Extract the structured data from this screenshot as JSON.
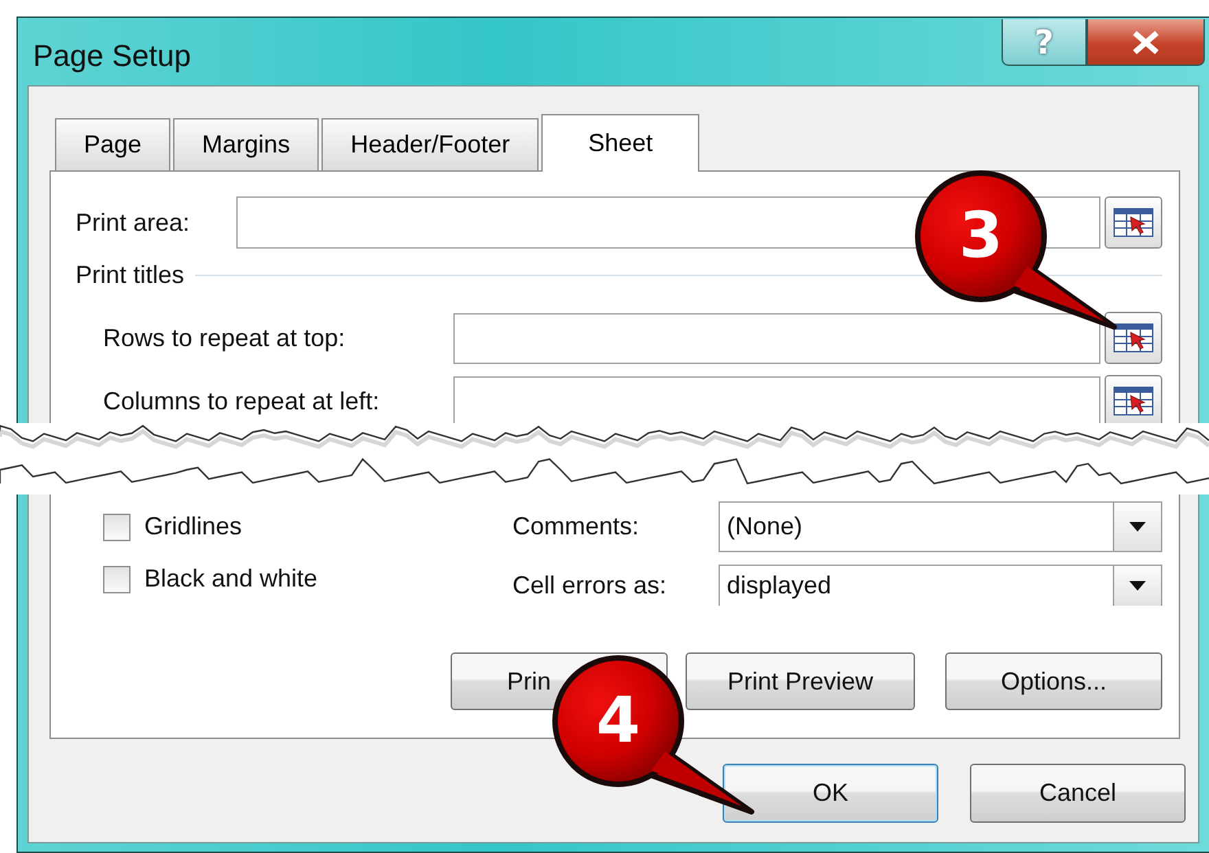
{
  "window": {
    "title": "Page Setup"
  },
  "title_buttons": [
    {
      "kind": "help",
      "label": "?"
    },
    {
      "kind": "close"
    }
  ],
  "tabs": [
    {
      "label": "Page",
      "selected": false
    },
    {
      "label": "Margins",
      "selected": false
    },
    {
      "label": "Header/Footer",
      "selected": false
    },
    {
      "label": "Sheet",
      "selected": true
    }
  ],
  "print_area": {
    "label": "Print area:"
  },
  "print_titles": {
    "heading": "Print titles",
    "rows": [
      {
        "label": "Rows to repeat at top:"
      },
      {
        "label": "Columns to repeat at left:"
      }
    ]
  },
  "print_options": [
    {
      "label": "Gridlines",
      "checked": false
    },
    {
      "label": "Black and white",
      "checked": false
    }
  ],
  "dropdowns": [
    {
      "label": "Comments:",
      "value": "(None)"
    },
    {
      "label": "Cell errors as:",
      "value": "displayed"
    }
  ],
  "panel_buttons": [
    "Prin",
    "Print Preview",
    "Options..."
  ],
  "dialog_buttons": [
    {
      "label": "OK",
      "default": true
    },
    {
      "label": "Cancel",
      "default": false
    }
  ],
  "callouts": [
    {
      "number": "3"
    },
    {
      "number": "4"
    }
  ]
}
